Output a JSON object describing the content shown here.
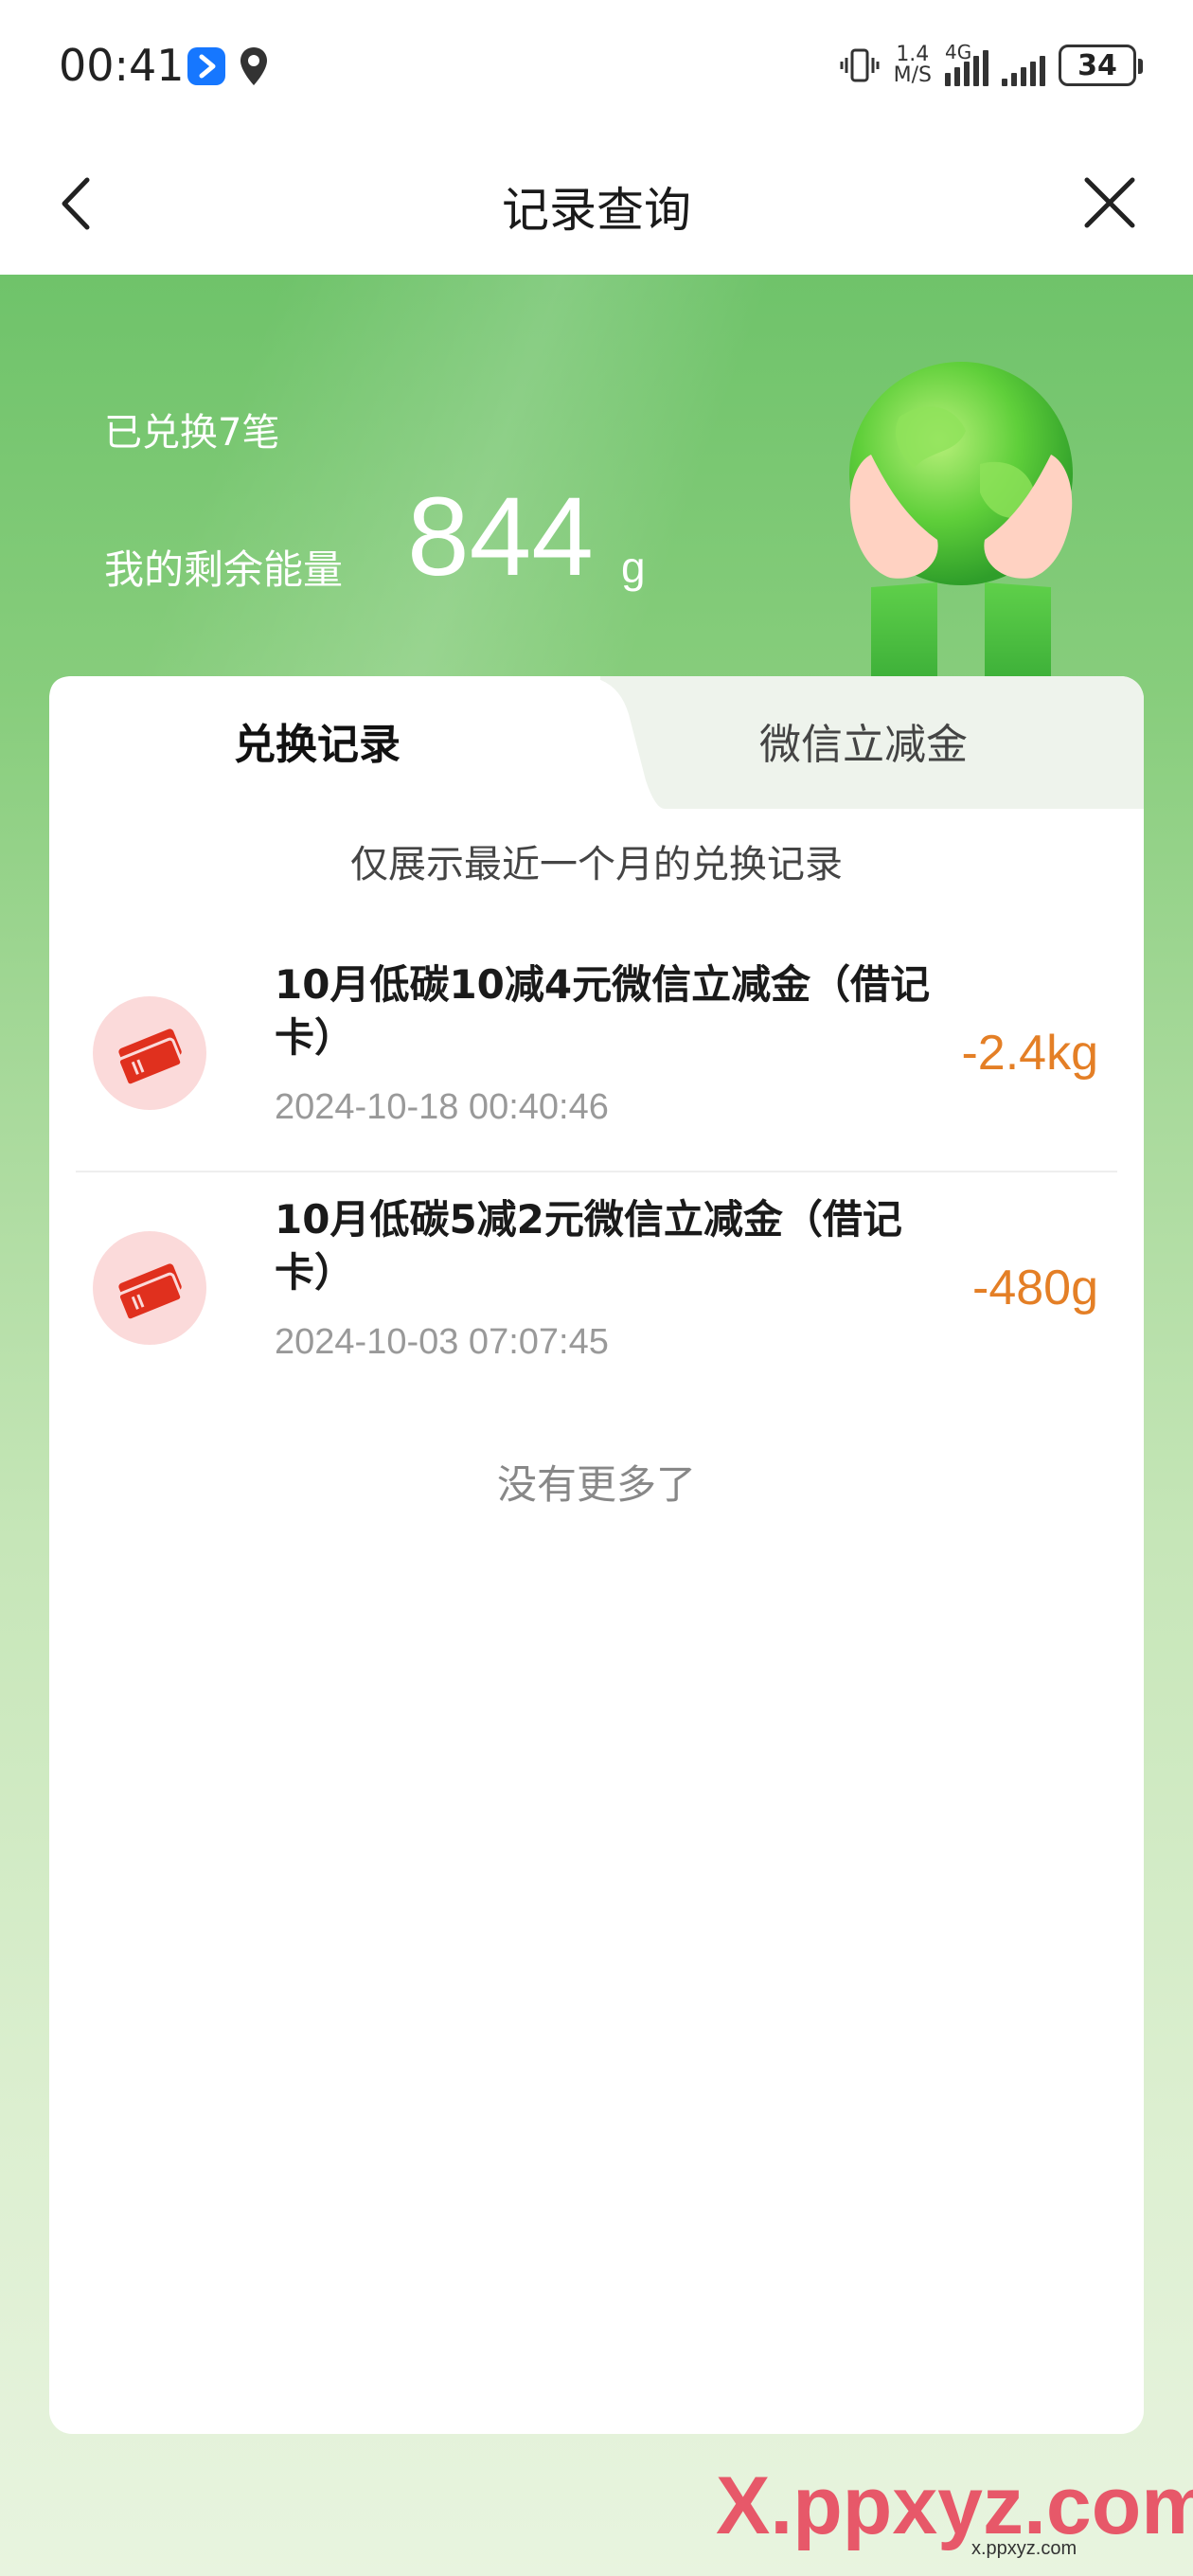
{
  "status_bar": {
    "time": "00:41",
    "net_speed_value": "1.4",
    "net_speed_unit": "M/S",
    "network": "4G",
    "battery": "34"
  },
  "nav": {
    "title": "记录查询",
    "back_icon": "chevron-left-icon",
    "close_icon": "close-icon"
  },
  "summary": {
    "exchange_count": "已兑换7笔",
    "energy_label": "我的剩余能量",
    "energy_value": "844",
    "energy_unit": "g"
  },
  "tabs": [
    {
      "label": "兑换记录",
      "active": true
    },
    {
      "label": "微信立减金",
      "active": false
    }
  ],
  "notice": "仅展示最近一个月的兑换记录",
  "records": [
    {
      "title": "10月低碳10减4元微信立减金（借记卡）",
      "time": "2024-10-18 00:40:46",
      "amount": "-2.4kg",
      "icon": "ticket-icon"
    },
    {
      "title": "10月低碳5减2元微信立减金（借记卡）",
      "time": "2024-10-03 07:07:45",
      "amount": "-480g",
      "icon": "ticket-icon"
    }
  ],
  "no_more": "没有更多了",
  "watermark": {
    "text": "X.ppxyz.com",
    "sub": "x.ppxyz.com"
  },
  "colors": {
    "accent_orange": "#e47f26",
    "green_header": "#6fc36a",
    "icon_red": "#e0301e",
    "icon_bg": "#fbdada"
  }
}
